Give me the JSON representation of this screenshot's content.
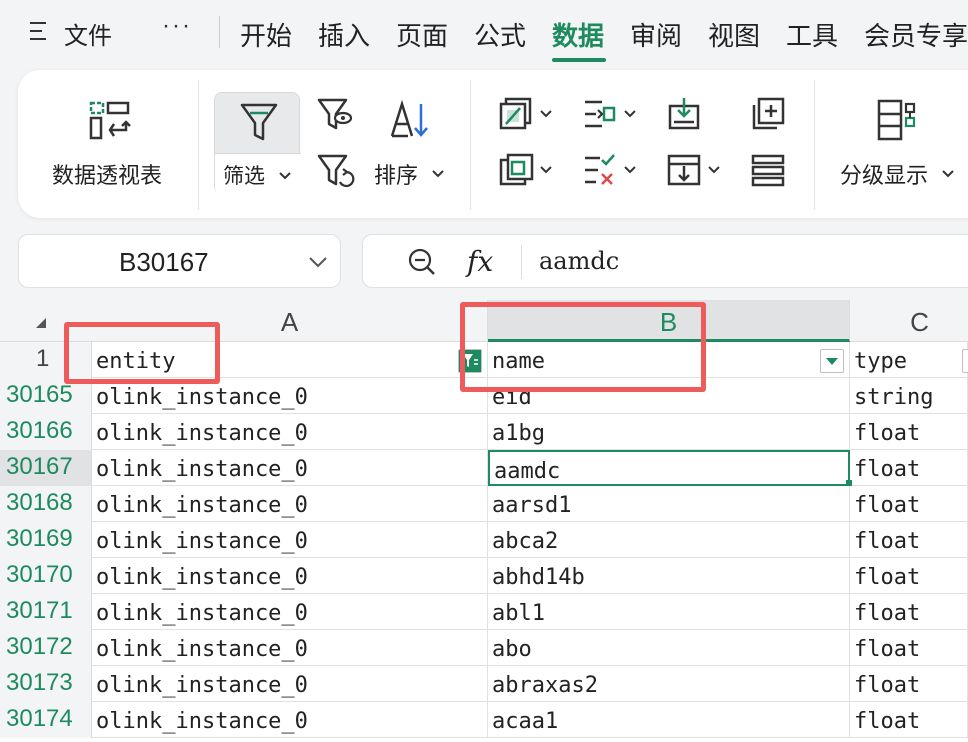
{
  "menubar": {
    "file_label": "文件",
    "more_label": "···",
    "tabs": [
      {
        "label": "开始",
        "active": false
      },
      {
        "label": "插入",
        "active": false
      },
      {
        "label": "页面",
        "active": false
      },
      {
        "label": "公式",
        "active": false
      },
      {
        "label": "数据",
        "active": true
      },
      {
        "label": "审阅",
        "active": false
      },
      {
        "label": "视图",
        "active": false
      },
      {
        "label": "工具",
        "active": false
      },
      {
        "label": "会员专享",
        "active": false
      }
    ]
  },
  "ribbon": {
    "pivot_label": "数据透视表",
    "filter_label": "筛选",
    "sort_label": "排序",
    "group_label": "分级显示"
  },
  "namebox": {
    "value": "B30167"
  },
  "formula": {
    "fx_label": "fx",
    "value": "aamdc"
  },
  "grid": {
    "columns": [
      "A",
      "B",
      "C"
    ],
    "selected_column": "B",
    "header_row": {
      "num": "1",
      "a": "entity",
      "b": "name",
      "c": "type"
    },
    "rows": [
      {
        "num": "30165",
        "a": "olink_instance_0",
        "b": "eid",
        "c": "string"
      },
      {
        "num": "30166",
        "a": "olink_instance_0",
        "b": "a1bg",
        "c": "float"
      },
      {
        "num": "30167",
        "a": "olink_instance_0",
        "b": "aamdc",
        "c": "float"
      },
      {
        "num": "30168",
        "a": "olink_instance_0",
        "b": "aarsd1",
        "c": "float"
      },
      {
        "num": "30169",
        "a": "olink_instance_0",
        "b": "abca2",
        "c": "float"
      },
      {
        "num": "30170",
        "a": "olink_instance_0",
        "b": "abhd14b",
        "c": "float"
      },
      {
        "num": "30171",
        "a": "olink_instance_0",
        "b": "abl1",
        "c": "float"
      },
      {
        "num": "30172",
        "a": "olink_instance_0",
        "b": "abo",
        "c": "float"
      },
      {
        "num": "30173",
        "a": "olink_instance_0",
        "b": "abraxas2",
        "c": "float"
      },
      {
        "num": "30174",
        "a": "olink_instance_0",
        "b": "acaa1",
        "c": "float"
      }
    ]
  },
  "colors": {
    "accent": "#1e8a5f",
    "highlight": "#ee5b5b"
  }
}
